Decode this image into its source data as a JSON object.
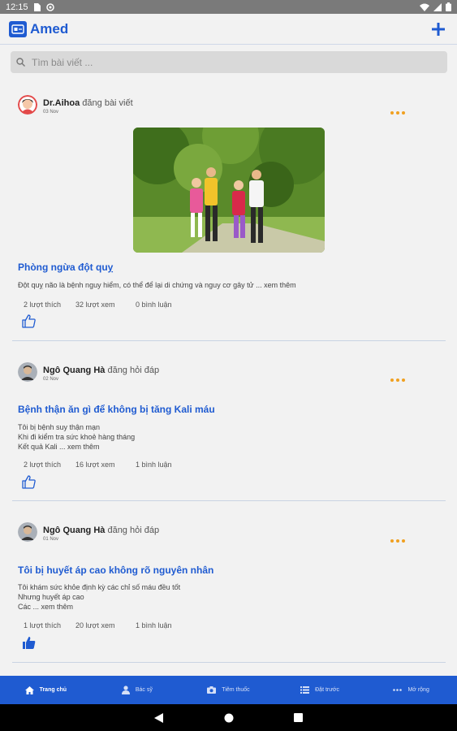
{
  "status_bar": {
    "time": "12:15"
  },
  "app": {
    "title": "Amed"
  },
  "search": {
    "placeholder": "Tìm bài viết ..."
  },
  "posts": [
    {
      "author": "Dr.Aihoa",
      "action": "đăng bài viết",
      "date": "03 Nov",
      "title": "Phòng ngừa đột quỵ",
      "body": [
        "Đột quỵ não là bệnh nguy hiểm, có thể để lại di chứng và nguy cơ gây tử ... xem thêm"
      ],
      "likes": "2 lượt thích",
      "views": "32 lượt xem",
      "comments": "0 bình luận",
      "liked": false
    },
    {
      "author": "Ngô Quang Hà",
      "action": "đăng hỏi đáp",
      "date": "02 Nov",
      "title": "Bệnh thận ăn gì để không bị tăng Kali máu",
      "body": [
        "Tôi bị bệnh suy thận mạn",
        "Khi đi kiểm tra sức khoẻ hàng tháng",
        "Kết quả Kali ... xem thêm"
      ],
      "likes": "2 lượt thích",
      "views": "16 lượt xem",
      "comments": "1 bình luận",
      "liked": false
    },
    {
      "author": "Ngô Quang Hà",
      "action": "đăng hỏi đáp",
      "date": "01 Nov",
      "title": "Tôi bị huyết áp cao không rõ nguyên nhân",
      "body": [
        "Tôi khám sức khỏe định kỳ các chỉ số máu đều tốt",
        "Nhưng huyết áp cao",
        "Các ... xem thêm"
      ],
      "likes": "1 lượt thích",
      "views": "20 lượt xem",
      "comments": "1 bình luận",
      "liked": true
    }
  ],
  "nav": [
    {
      "label": "Trang chủ",
      "icon": "home-icon",
      "active": true
    },
    {
      "label": "Bác sỹ",
      "icon": "doctor-icon",
      "active": false
    },
    {
      "label": "Tiêm thuốc",
      "icon": "camera-icon",
      "active": false
    },
    {
      "label": "Đặt trước",
      "icon": "list-icon",
      "active": false
    },
    {
      "label": "Mở rộng",
      "icon": "more-icon",
      "active": false
    }
  ],
  "colors": {
    "primary": "#1f5bd1",
    "accent": "#f0a020",
    "divider": "#c9d3e3"
  }
}
